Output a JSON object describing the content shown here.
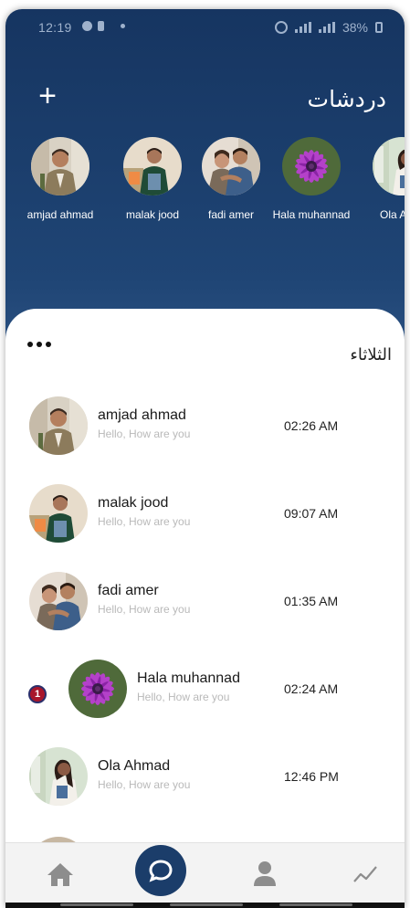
{
  "status_bar": {
    "time": "12:19",
    "battery": "38%"
  },
  "header": {
    "title": "دردشات",
    "add_icon": "plus-icon"
  },
  "stories": [
    {
      "name": "amjad ahmad",
      "avatar": "man-suit"
    },
    {
      "name": "malak jood",
      "avatar": "student-green"
    },
    {
      "name": "fadi amer",
      "avatar": "couple-hug"
    },
    {
      "name": "Hala muhannad",
      "avatar": "purple-flower"
    },
    {
      "name": "Ola A",
      "avatar": "woman-campus"
    }
  ],
  "chat_list": {
    "day_label": "الثلاثاء",
    "more_icon": "more-dots-icon",
    "items": [
      {
        "name": "amjad ahmad",
        "preview": "Hello, How are you",
        "time": "02:26 AM",
        "unread": null
      },
      {
        "name": "malak jood",
        "preview": "Hello, How are you",
        "time": "09:07 AM",
        "unread": null
      },
      {
        "name": "fadi amer",
        "preview": "Hello, How are you",
        "time": "01:35 AM",
        "unread": null
      },
      {
        "name": "Hala muhannad",
        "preview": "Hello, How are you",
        "time": "02:24 AM",
        "unread": "1"
      },
      {
        "name": "Ola Ahmad",
        "preview": "Hello, How are you",
        "time": "12:46 PM",
        "unread": null
      }
    ]
  },
  "bottom_nav": {
    "items": [
      "home-icon",
      "chat-icon",
      "person-icon",
      "trend-icon"
    ],
    "active": "chat-icon"
  },
  "colors": {
    "header_gradient_top": "#163561",
    "header_gradient_bottom": "#4a70a0",
    "active_nav": "#1b3d6a",
    "unread_badge": "#a8162b"
  }
}
